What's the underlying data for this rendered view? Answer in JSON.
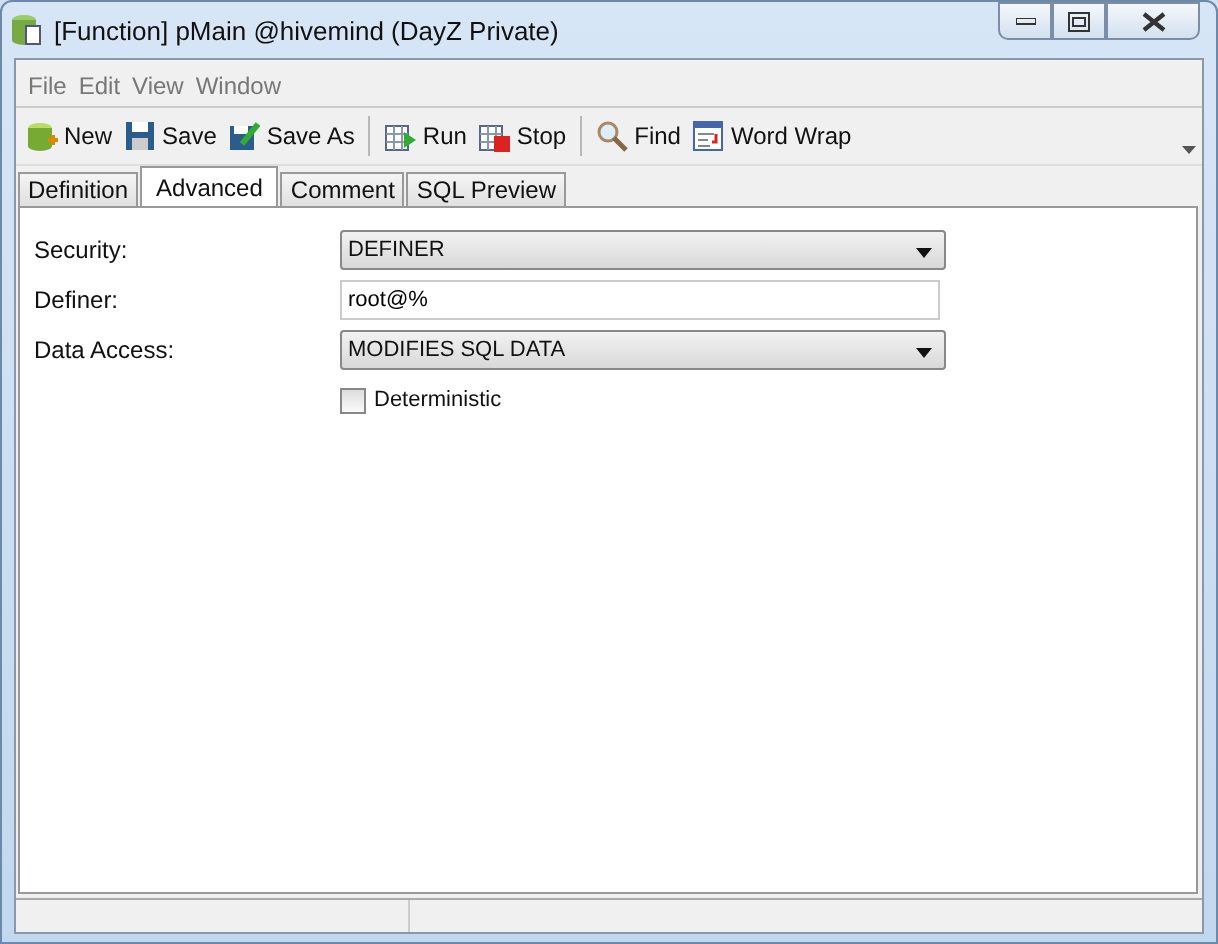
{
  "window": {
    "title": "[Function] pMain @hivemind (DayZ Private)"
  },
  "menu": [
    "File",
    "Edit",
    "View",
    "Window"
  ],
  "toolbar": {
    "groups": [
      [
        "New",
        "Save",
        "Save As"
      ],
      [
        "Run",
        "Stop"
      ],
      [
        "Find",
        "Word Wrap"
      ]
    ]
  },
  "tabs": [
    {
      "label": "Definition",
      "selected": false
    },
    {
      "label": "Advanced",
      "selected": true
    },
    {
      "label": "Comment",
      "selected": false
    },
    {
      "label": "SQL Preview",
      "selected": false
    }
  ],
  "fields": [
    {
      "kind": "select",
      "label": "Security:",
      "value": "DEFINER"
    },
    {
      "kind": "text",
      "label": "Definer:",
      "value": "root@%"
    },
    {
      "kind": "select",
      "label": "Data Access:",
      "value": "MODIFIES SQL DATA"
    },
    {
      "kind": "checkbox",
      "label": "Deterministic",
      "checked": false
    }
  ]
}
